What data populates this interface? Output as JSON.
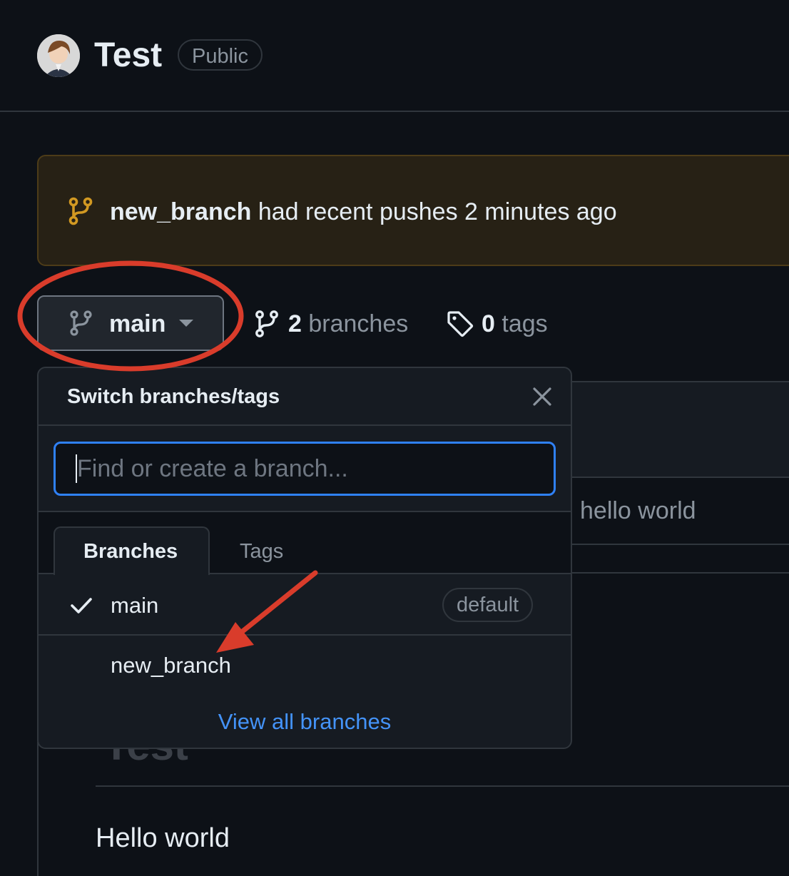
{
  "header": {
    "repo_name": "Test",
    "visibility": "Public"
  },
  "push_banner": {
    "branch": "new_branch",
    "message": " had recent pushes 2 minutes ago"
  },
  "branch_selector": {
    "current_branch": "main"
  },
  "counts": {
    "branches_num": "2",
    "branches_label": " branches",
    "tags_num": "0",
    "tags_label": " tags"
  },
  "background": {
    "commit_message": "hello world",
    "readme_heading": "Test",
    "readme_body": "Hello world"
  },
  "dropdown": {
    "title": "Switch branches/tags",
    "search_placeholder": "Find or create a branch...",
    "tabs": [
      {
        "label": "Branches",
        "active": true
      },
      {
        "label": "Tags",
        "active": false
      }
    ],
    "items": [
      {
        "label": "main",
        "checked": true,
        "badge": "default"
      },
      {
        "label": "new_branch",
        "checked": false
      }
    ],
    "view_all": "View all branches"
  },
  "colors": {
    "background": "#0d1117",
    "accent_blue": "#4493f8",
    "banner_icon": "#d29922",
    "annotation_red": "#d93c2b"
  },
  "icons": [
    "avatar",
    "git-branch-icon",
    "tag-icon",
    "close-icon",
    "check-icon",
    "chevron-down-icon"
  ]
}
